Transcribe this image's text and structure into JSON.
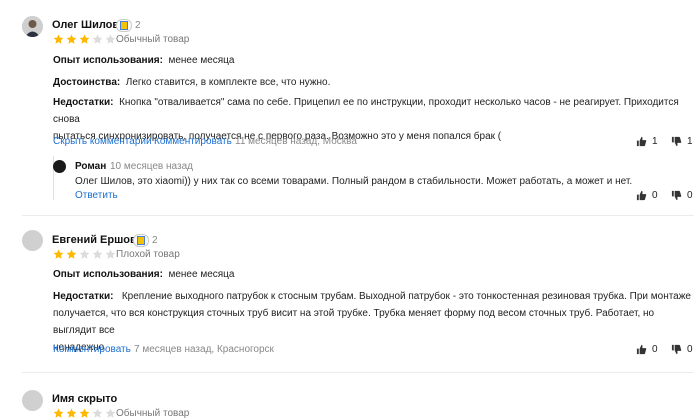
{
  "reviews": [
    {
      "author": "Олег Шилов",
      "badge_count": "2",
      "rating": 3,
      "rating_label": "Обычный товар",
      "usage_label": "Опыт использования:",
      "usage_value": "менее месяца",
      "pros_label": "Достоинства:",
      "pros_value": "Легко ставится, в комплекте все, что нужно.",
      "cons_label": "Недостатки:",
      "cons_line1": "Кнопка \"отваливается\" сама по себе. Прицепил ее по инструкции, проходит несколько часов - не реагирует. Приходится снова",
      "cons_line2": "пытаться синхронизировать, получается не с первого раза. Возможно это у меня попался брак (",
      "hide_comments": "Скрыть комментарии",
      "comment_link": "Комментировать",
      "meta": "11 месяцев назад, Москва",
      "likes": "1",
      "dislikes": "1",
      "reply": {
        "author": "Роман",
        "time": "10 месяцев назад",
        "text": "Олег Шилов, это xiaomi)) у них так со всеми товарами. Полный рандом в стабильности. Может работать, а может и нет.",
        "reply_link": "Ответить",
        "likes": "0",
        "dislikes": "0"
      }
    },
    {
      "author": "Евгений Ершов",
      "badge_count": "2",
      "rating": 2,
      "rating_label": "Плохой товар",
      "usage_label": "Опыт использования:",
      "usage_value": "менее месяца",
      "cons_label": "Недостатки:",
      "cons_line1": "Крепление выходного патрубок к стосным трубам. Выходной патрубок - это тонкостенная резиновая трубка. При монтаже",
      "cons_line2": "получается, что вся конструкция сточных труб висит на этой трубке. Трубка меняет форму под весом сточных труб. Работает, но выглядит все",
      "cons_line3": "ненадежно",
      "comment_link": "Комментировать",
      "meta": "7 месяцев назад, Красногорск",
      "likes": "0",
      "dislikes": "0"
    },
    {
      "author": "Имя скрыто",
      "rating": 3,
      "rating_label": "Обычный товар"
    }
  ],
  "colors": {
    "star_on": "#ffb800",
    "star_off": "#dcdcdc",
    "link": "#1a6fd1"
  }
}
